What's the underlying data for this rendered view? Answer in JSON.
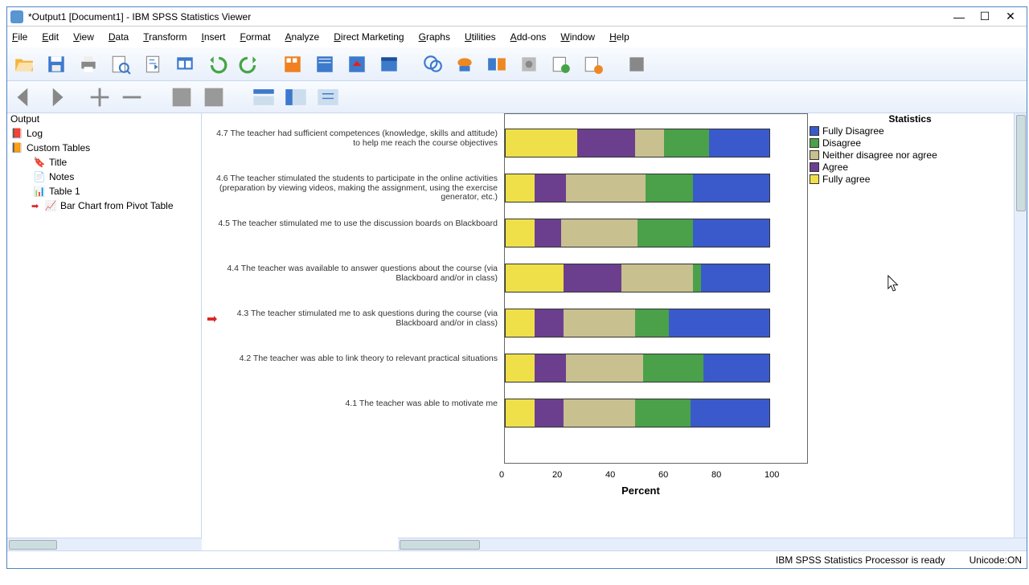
{
  "window": {
    "title": "*Output1 [Document1] - IBM SPSS Statistics Viewer"
  },
  "menu": {
    "file": "File",
    "edit": "Edit",
    "view": "View",
    "data": "Data",
    "transform": "Transform",
    "insert": "Insert",
    "format": "Format",
    "analyze": "Analyze",
    "dm": "Direct Marketing",
    "graphs": "Graphs",
    "utils": "Utilities",
    "addons": "Add-ons",
    "window": "Window",
    "help": "Help"
  },
  "outline": {
    "root": "Output",
    "items": [
      {
        "label": "Log"
      },
      {
        "label": "Custom Tables"
      },
      {
        "label": "Title"
      },
      {
        "label": "Notes"
      },
      {
        "label": "Table 1"
      },
      {
        "label": "Bar Chart from Pivot Table"
      }
    ]
  },
  "legend": {
    "title": "Statistics",
    "items": [
      {
        "label": "Fully Disagree",
        "color": "#3a5acc"
      },
      {
        "label": "Disagree",
        "color": "#4aa14a"
      },
      {
        "label": "Neither disagree nor agree",
        "color": "#c8c08f"
      },
      {
        "label": "Agree",
        "color": "#6c3f8e"
      },
      {
        "label": "Fully agree",
        "color": "#efe04a"
      }
    ]
  },
  "chart_data": {
    "type": "bar",
    "stacked": true,
    "orientation": "horizontal",
    "title": "",
    "xlabel": "Percent",
    "ylabel": "",
    "xlim": [
      0,
      100
    ],
    "ticks": [
      0,
      20,
      40,
      60,
      80,
      100
    ],
    "series": [
      {
        "name": "Fully agree",
        "values": [
          27,
          11,
          11,
          22,
          11,
          11,
          11
        ]
      },
      {
        "name": "Agree",
        "values": [
          22,
          12,
          10,
          22,
          11,
          12,
          11
        ]
      },
      {
        "name": "Neither disagree nor agree",
        "values": [
          11,
          30,
          29,
          27,
          27,
          29,
          27
        ]
      },
      {
        "name": "Disagree",
        "values": [
          17,
          18,
          21,
          3,
          13,
          23,
          21
        ]
      },
      {
        "name": "Fully Disagree",
        "values": [
          23,
          29,
          29,
          26,
          38,
          25,
          30
        ]
      }
    ],
    "categories": [
      "4.7 The teacher had sufficient competences (knowledge, skills and attitude)  to help me reach the course objectives",
      "4.6 The teacher stimulated the students to participate in the online activities (preparation by viewing videos, making the assignment, using the exercise generator, etc.)",
      "4.5 The teacher stimulated me to use the discussion boards on Blackboard",
      "4.4 The teacher was available to answer questions about the course (via Blackboard and/or in class)",
      "4.3 The teacher stimulated me to ask questions during the course (via Blackboard and/or in class)",
      "4.2 The teacher was able to link theory to relevant practical situations",
      "4.1 The teacher was able to motivate me"
    ]
  },
  "status": {
    "processor": "IBM SPSS Statistics Processor is ready",
    "unicode": "Unicode:ON"
  }
}
